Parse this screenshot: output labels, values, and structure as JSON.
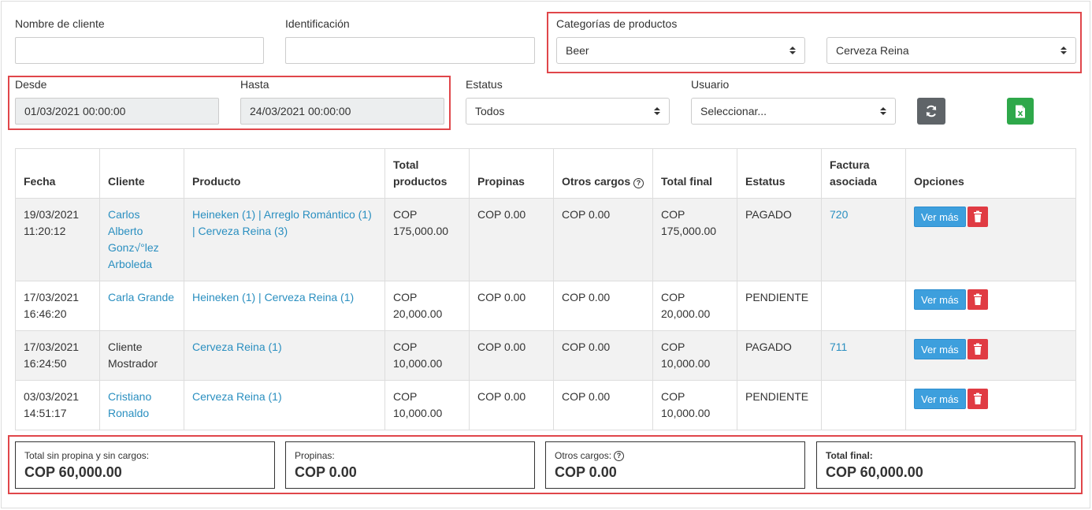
{
  "filters": {
    "nombre_label": "Nombre de cliente",
    "nombre_value": "",
    "identificacion_label": "Identificación",
    "identificacion_value": "",
    "categorias_label": "Categorías de productos",
    "categoria_selected": "Beer",
    "producto_selected": "Cerveza Reina",
    "desde_label": "Desde",
    "desde_value": "01/03/2021 00:00:00",
    "hasta_label": "Hasta",
    "hasta_value": "24/03/2021 00:00:00",
    "estatus_label": "Estatus",
    "estatus_selected": "Todos",
    "usuario_label": "Usuario",
    "usuario_selected": "Seleccionar...",
    "refresh_icon": "refresh-icon",
    "excel_icon": "excel-icon"
  },
  "table": {
    "headers": {
      "fecha": "Fecha",
      "cliente": "Cliente",
      "producto": "Producto",
      "total_productos_1": "Total",
      "total_productos_2": "productos",
      "propinas": "Propinas",
      "otros_cargos": "Otros cargos",
      "total_final": "Total final",
      "estatus": "Estatus",
      "factura_1": "Factura",
      "factura_2": "asociada",
      "opciones": "Opciones"
    },
    "rows": [
      {
        "fecha_1": "19/03/2021",
        "fecha_2": "11:20:12",
        "cliente": "Carlos Alberto Gonz√°lez Arboleda",
        "producto": "Heineken (1) | Arreglo Romántico (1) | Cerveza Reina (3)",
        "total_productos_1": "COP",
        "total_productos_2": "175,000.00",
        "propinas": "COP 0.00",
        "otros_cargos": "COP 0.00",
        "total_final_1": "COP",
        "total_final_2": "175,000.00",
        "estatus": "PAGADO",
        "factura": "720",
        "ver_label": "Ver más"
      },
      {
        "fecha_1": "17/03/2021",
        "fecha_2": "16:46:20",
        "cliente": "Carla Grande",
        "producto": "Heineken (1) | Cerveza Reina (1)",
        "total_productos_1": "COP",
        "total_productos_2": "20,000.00",
        "propinas": "COP 0.00",
        "otros_cargos": "COP 0.00",
        "total_final_1": "COP",
        "total_final_2": "20,000.00",
        "estatus": "PENDIENTE",
        "factura": "",
        "ver_label": "Ver más"
      },
      {
        "fecha_1": "17/03/2021",
        "fecha_2": "16:24:50",
        "cliente": "Cliente Mostrador",
        "producto": "Cerveza Reina (1)",
        "total_productos_1": "COP",
        "total_productos_2": "10,000.00",
        "propinas": "COP 0.00",
        "otros_cargos": "COP 0.00",
        "total_final_1": "COP",
        "total_final_2": "10,000.00",
        "estatus": "PAGADO",
        "factura": "711",
        "ver_label": "Ver más"
      },
      {
        "fecha_1": "03/03/2021",
        "fecha_2": "14:51:17",
        "cliente": "Cristiano Ronaldo",
        "producto": "Cerveza Reina (1)",
        "total_productos_1": "COP",
        "total_productos_2": "10,000.00",
        "propinas": "COP 0.00",
        "otros_cargos": "COP 0.00",
        "total_final_1": "COP",
        "total_final_2": "10,000.00",
        "estatus": "PENDIENTE",
        "factura": "",
        "ver_label": "Ver más"
      }
    ]
  },
  "summary": {
    "total_sin_label": "Total sin propina y sin cargos:",
    "total_sin_value": "COP 60,000.00",
    "propinas_label": "Propinas:",
    "propinas_value": "COP 0.00",
    "otros_label": "Otros cargos:",
    "otros_value": "COP 0.00",
    "final_label": "Total final:",
    "final_value": "COP 60,000.00"
  },
  "colors": {
    "highlight": "#e0464a",
    "link": "#2a8fc0",
    "ver_button": "#3d9fdd",
    "delete_button": "#e03b43",
    "refresh_button": "#5f6468",
    "excel_button": "#2ea84a"
  }
}
